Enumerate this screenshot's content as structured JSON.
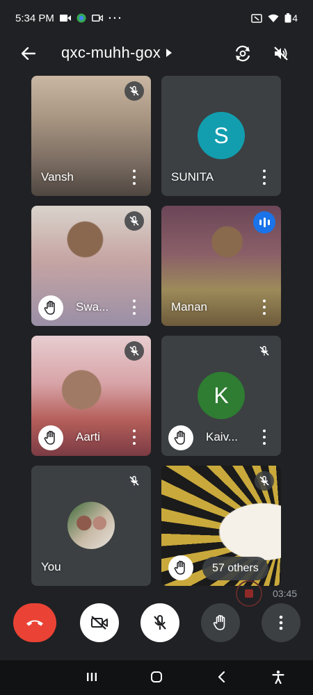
{
  "status_bar": {
    "time": "5:34 PM",
    "battery": "4"
  },
  "header": {
    "meeting_code": "qxc-muhh-gox"
  },
  "participants": [
    {
      "name": "Vansh"
    },
    {
      "name": "SUNITA",
      "avatar_letter": "S",
      "avatar_color": "#129eaf"
    },
    {
      "name": "Swa..."
    },
    {
      "name": "Manan"
    },
    {
      "name": "Aarti"
    },
    {
      "name": "Kaiv...",
      "avatar_letter": "K",
      "avatar_color": "#2e7d32"
    },
    {
      "name": "You"
    }
  ],
  "others_label": "57 others",
  "recording": {
    "elapsed": "03:45"
  },
  "colors": {
    "end_call": "#ea4335",
    "speaking": "#1a73e8",
    "tile": "#3c4043",
    "background": "#202124"
  },
  "icons": [
    "back-arrow-icon",
    "caret-right-icon",
    "switch-camera-icon",
    "speaker-off-icon",
    "mic-off-icon",
    "raised-hand-icon",
    "more-vert-icon",
    "phone-hangup-icon",
    "camera-off-icon",
    "accessibility-icon"
  ]
}
